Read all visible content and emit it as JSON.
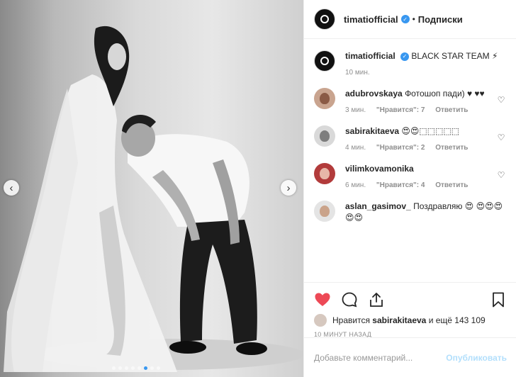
{
  "photo": {
    "prev_arrow": "‹",
    "next_arrow": "›",
    "carousel_count": 8,
    "carousel_active": 6
  },
  "header": {
    "username": "timatiofficial",
    "separator": "•",
    "follow_label": "Подписки"
  },
  "caption": {
    "username": "timatiofficial",
    "text": "BLACK STAR TEAM ⚡",
    "time": "10 мин."
  },
  "comments": [
    {
      "username": "adubrovskaya",
      "text": "Фотошоп пади) ♥ ♥♥",
      "time": "3 мин.",
      "likes": "\"Нравится\": 7",
      "reply": "Ответить"
    },
    {
      "username": "sabirakitaeva",
      "text": "😍😍⬚⬚⬚⬚⬚",
      "time": "4 мин.",
      "likes": "\"Нравится\": 2",
      "reply": "Ответить"
    },
    {
      "username": "vilimkovamonika",
      "text": "",
      "time": "6 мин.",
      "likes": "\"Нравится\": 4",
      "reply": "Ответить"
    },
    {
      "username": "aslan_gasimov_",
      "text": "Поздравляю 😍 😍😍😍😍😍",
      "time": "",
      "likes": "",
      "reply": ""
    }
  ],
  "likes_bar": {
    "prefix": "Нравится",
    "user": "sabirakitaeva",
    "suffix": "и ещё 143 109"
  },
  "posted": "10 МИНУТ НАЗАД",
  "comment_box": {
    "placeholder": "Добавьте комментарий...",
    "publish_label": "Опубликовать"
  },
  "colors": {
    "like_red": "#ed4956",
    "verified_blue": "#3897f0",
    "publish_disabled": "#b2dffc"
  }
}
